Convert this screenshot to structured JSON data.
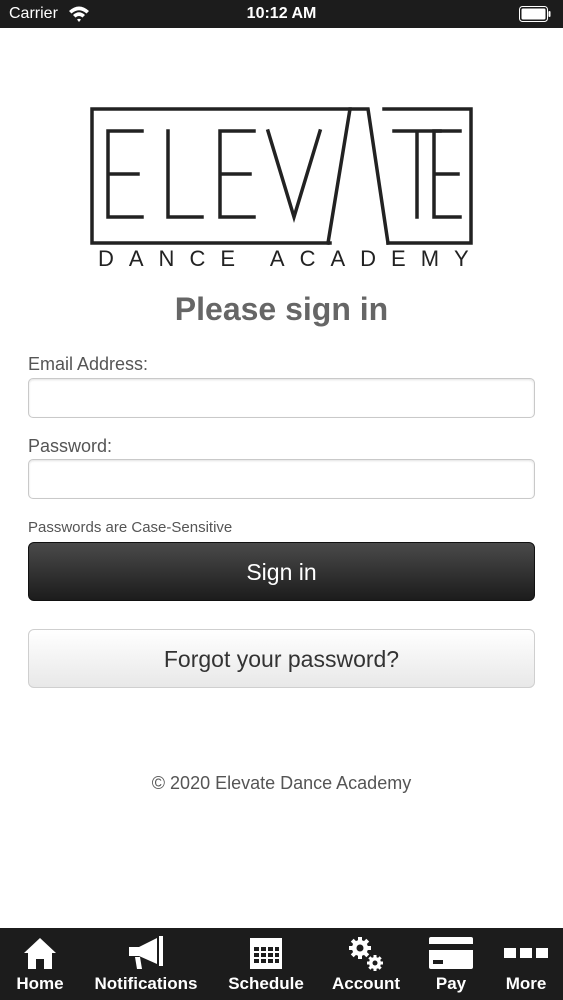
{
  "status_bar": {
    "carrier": "Carrier",
    "time": "10:12 AM"
  },
  "logo": {
    "word": "ELEVATE",
    "subtitle": "DANCE ACADEMY"
  },
  "form": {
    "title": "Please sign in",
    "email_label": "Email Address:",
    "email_value": "",
    "password_label": "Password:",
    "password_value": "",
    "hint": "Passwords are Case-Sensitive",
    "signin_label": "Sign in",
    "forgot_label": "Forgot your password?"
  },
  "footer": {
    "copyright": "© 2020 Elevate Dance Academy"
  },
  "tabbar": {
    "items": [
      {
        "label": "Home",
        "icon": "home-icon"
      },
      {
        "label": "Notifications",
        "icon": "megaphone-icon"
      },
      {
        "label": "Schedule",
        "icon": "calendar-icon"
      },
      {
        "label": "Account",
        "icon": "gears-icon"
      },
      {
        "label": "Pay",
        "icon": "credit-card-icon"
      },
      {
        "label": "More",
        "icon": "more-icon"
      }
    ]
  }
}
